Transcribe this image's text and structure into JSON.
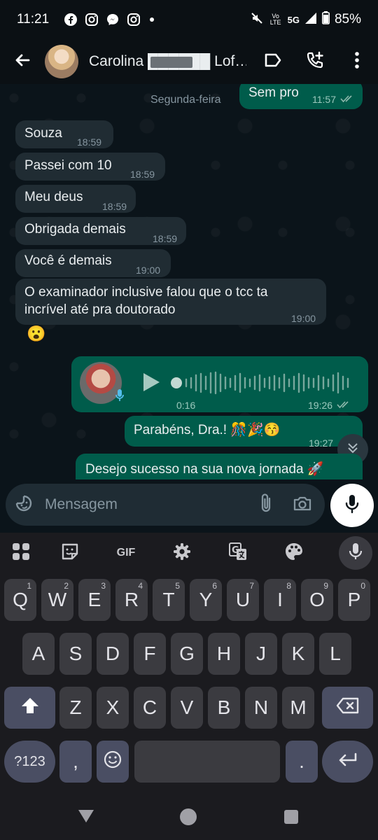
{
  "status_bar": {
    "time": "11:21",
    "network_label": "5G",
    "volte_label": "Vo LTE",
    "battery": "85%"
  },
  "header": {
    "contact_name": "Carolina ██████ Lof…",
    "icons": [
      "back-arrow-icon",
      "label-icon",
      "add-call-icon",
      "more-vert-icon"
    ]
  },
  "chat": {
    "day_label": "Segunda-feira",
    "first_out": {
      "text": "Sem pro",
      "time": "11:57"
    },
    "incoming": [
      {
        "text": "Souza",
        "time": "18:59"
      },
      {
        "text": "Passei com 10",
        "time": "18:59"
      },
      {
        "text": "Meu deus",
        "time": "18:59"
      },
      {
        "text": "Obrigada demais",
        "time": "18:59"
      },
      {
        "text": "Você é demais",
        "time": "19:00"
      }
    ],
    "long_message": {
      "line1": "O examinador inclusive falou que o tcc ta",
      "line2": "incrível até pra doutorado",
      "time": "19:00",
      "reaction": "😮"
    },
    "voice_note": {
      "duration": "0:16",
      "time": "19:26",
      "progress": 0
    },
    "congrats": {
      "text": "Parabéns, Dra.! 🎊🎉😚",
      "time": "19:27"
    },
    "last_message": {
      "text": "Desejo sucesso na sua nova jornada 🚀"
    }
  },
  "composer": {
    "placeholder": "Mensagem"
  },
  "keyboard": {
    "toolbar": {
      "gif": "GIF"
    },
    "row1": [
      {
        "k": "Q",
        "n": "1"
      },
      {
        "k": "W",
        "n": "2"
      },
      {
        "k": "E",
        "n": "3"
      },
      {
        "k": "R",
        "n": "4"
      },
      {
        "k": "T",
        "n": "5"
      },
      {
        "k": "Y",
        "n": "6"
      },
      {
        "k": "U",
        "n": "7"
      },
      {
        "k": "I",
        "n": "8"
      },
      {
        "k": "O",
        "n": "9"
      },
      {
        "k": "P",
        "n": "0"
      }
    ],
    "row2": [
      "A",
      "S",
      "D",
      "F",
      "G",
      "H",
      "J",
      "K",
      "L"
    ],
    "row3": [
      "Z",
      "X",
      "C",
      "V",
      "B",
      "N",
      "M"
    ],
    "bottom": {
      "symbols": "?123",
      "comma": ",",
      "period": "."
    }
  },
  "colors": {
    "incoming_bubble": "#202c33",
    "outgoing_bubble": "#005c4b",
    "chat_background": "#0b141a",
    "accent_ticks": "#53bdeb"
  }
}
